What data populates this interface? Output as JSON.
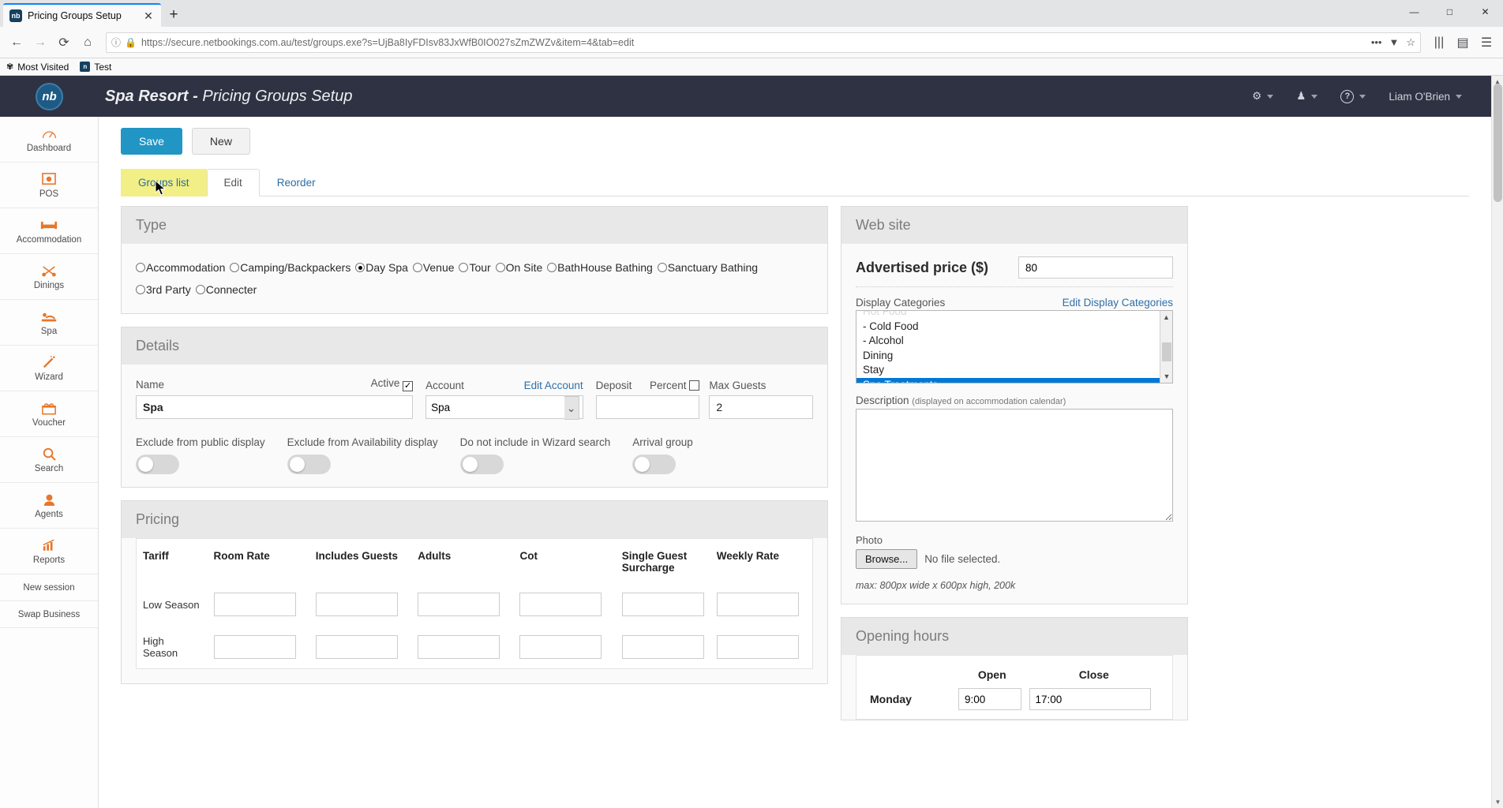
{
  "browser": {
    "tab_title": "Pricing Groups Setup",
    "tab_favicon": "nb",
    "new_tab_icon": "+",
    "close_icon": "✕",
    "back_icon": "←",
    "forward_icon": "→",
    "reload_icon": "⟳",
    "home_icon": "⌂",
    "info_icon": "ⓘ",
    "lock_icon": "🔒",
    "url_scheme": "https://secure.",
    "url_domain": "netbookings.com.au",
    "url_path": "/test/groups.exe?s=UjBa8IyFDIsv83JxWfB0IO027sZmZWZv&item=4&tab=edit",
    "url_full": "https://secure.netbookings.com.au/test/groups.exe?s=UjBa8IyFDIsv83JxWfB0IO027sZmZWZv&item=4&tab=edit",
    "ellipsis_icon": "•••",
    "pocket_icon": "▼",
    "star_icon": "☆",
    "library_icon": "|||",
    "sidebar_icon": "▤",
    "menu_icon": "☰",
    "minimize_icon": "—",
    "maximize_icon": "□",
    "window_close_icon": "✕",
    "bookmarks": [
      {
        "label": "Most Visited",
        "icon": "most-visited-icon"
      },
      {
        "label": "Test",
        "icon": "nb-favicon"
      }
    ]
  },
  "header": {
    "logo_text": "nb",
    "business": "Spa Resort",
    "separator": " - ",
    "page": "Pricing Groups Setup",
    "title_full": "Spa Resort - Pricing Groups Setup",
    "gear_icon": "⚙",
    "user_icon": "♟",
    "help_icon": "?",
    "user_name": "Liam O'Brien"
  },
  "sidebar": {
    "items": [
      {
        "label": "Dashboard",
        "icon": "⌁"
      },
      {
        "label": "POS",
        "icon": "▣"
      },
      {
        "label": "Accommodation",
        "icon": "🛏"
      },
      {
        "label": "Dinings",
        "icon": "🍴"
      },
      {
        "label": "Spa",
        "icon": "💆"
      },
      {
        "label": "Wizard",
        "icon": "✨"
      },
      {
        "label": "Voucher",
        "icon": "🎁"
      },
      {
        "label": "Search",
        "icon": "🔍"
      },
      {
        "label": "Agents",
        "icon": "👤"
      },
      {
        "label": "Reports",
        "icon": "📈"
      }
    ],
    "plain_items": [
      {
        "label": "New session"
      },
      {
        "label": "Swap Business"
      }
    ]
  },
  "toolbar": {
    "save_label": "Save",
    "new_label": "New"
  },
  "tabs": [
    {
      "label": "Groups list",
      "state": "highlighted"
    },
    {
      "label": "Edit",
      "state": "active"
    },
    {
      "label": "Reorder",
      "state": "normal"
    }
  ],
  "type_panel": {
    "title": "Type",
    "options": [
      {
        "label": "Accommodation",
        "selected": false
      },
      {
        "label": "Camping/Backpackers",
        "selected": false
      },
      {
        "label": "Day Spa",
        "selected": true
      },
      {
        "label": "Venue",
        "selected": false
      },
      {
        "label": "Tour",
        "selected": false
      },
      {
        "label": "On Site",
        "selected": false
      },
      {
        "label": "BathHouse Bathing",
        "selected": false
      },
      {
        "label": "Sanctuary Bathing",
        "selected": false
      },
      {
        "label": "3rd Party",
        "selected": false
      },
      {
        "label": "Connecter",
        "selected": false
      }
    ]
  },
  "details_panel": {
    "title": "Details",
    "name_label": "Name",
    "name_value": "Spa",
    "active_label": "Active",
    "active_checked": true,
    "check_glyph": "✓",
    "account_label": "Account",
    "account_value": "Spa",
    "edit_account_link": "Edit Account",
    "deposit_label": "Deposit",
    "deposit_value": "",
    "percent_label": "Percent",
    "percent_checked": false,
    "max_guests_label": "Max Guests",
    "max_guests_value": "2",
    "toggles": [
      {
        "label": "Exclude from public display",
        "on": false
      },
      {
        "label": "Exclude from Availability display",
        "on": false
      },
      {
        "label": "Do not include in Wizard search",
        "on": false
      },
      {
        "label": "Arrival group",
        "on": false
      }
    ]
  },
  "pricing_panel": {
    "title": "Pricing",
    "columns": [
      "Tariff",
      "Room Rate",
      "Includes Guests",
      "Adults",
      "Cot",
      "Single Guest Surcharge",
      "Weekly Rate"
    ],
    "rows": [
      {
        "tariff": "Low Season",
        "values": [
          "",
          "",
          "",
          "",
          "",
          ""
        ]
      },
      {
        "tariff": "High Season",
        "values": [
          "",
          "",
          "",
          "",
          "",
          ""
        ]
      }
    ]
  },
  "website_panel": {
    "title": "Web site",
    "advertised_price_label": "Advertised price ($)",
    "advertised_price_value": "80",
    "display_categories_label": "Display Categories",
    "edit_display_categories_link": "Edit Display Categories",
    "categories": [
      {
        "label": "Hot Food",
        "selected": false,
        "clipped": true
      },
      {
        "label": "- Cold Food",
        "selected": false
      },
      {
        "label": "- Alcohol",
        "selected": false
      },
      {
        "label": "Dining",
        "selected": false
      },
      {
        "label": "Stay",
        "selected": false
      },
      {
        "label": "Spa Treatments",
        "selected": true
      }
    ],
    "scroll_up_icon": "▲",
    "scroll_down_icon": "▼",
    "description_label": "Description",
    "description_note": "(displayed on accommodation calendar)",
    "description_value": "",
    "photo_label": "Photo",
    "browse_label": "Browse...",
    "no_file_text": "No file selected.",
    "max_note": "max: 800px wide x 600px high, 200k"
  },
  "opening_hours_panel": {
    "title": "Opening hours",
    "columns": [
      "Open",
      "Close"
    ],
    "rows": [
      {
        "day": "Monday",
        "open": "9:00",
        "close": "17:00"
      }
    ]
  }
}
